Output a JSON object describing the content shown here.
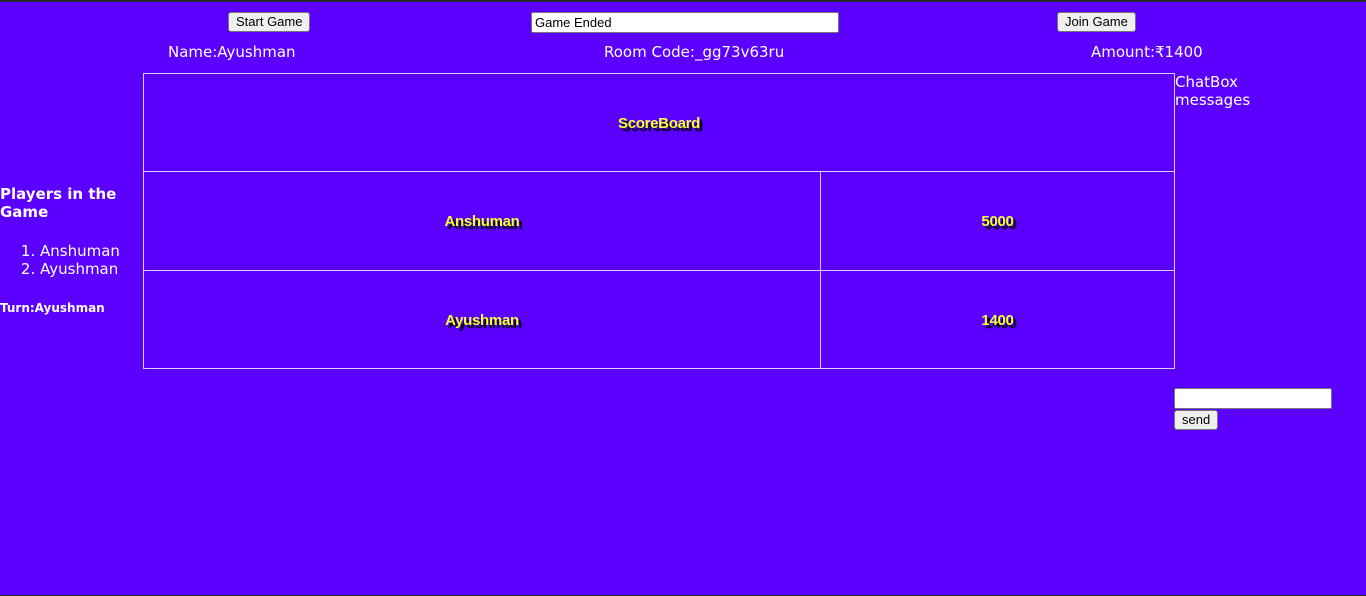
{
  "toolbar": {
    "start_label": "Start Game",
    "status_value": "Game Ended",
    "join_label": "Join Game"
  },
  "info": {
    "name": "Name:Ayushman",
    "room_code": "Room Code:_gg73v63ru",
    "amount": "Amount:₹1400"
  },
  "players": {
    "heading": "Players in the Game",
    "items": [
      "Anshuman",
      "Ayushman"
    ],
    "turn": "Turn:Ayushman"
  },
  "scoreboard": {
    "title": "ScoreBoard",
    "rows": [
      {
        "name": "Anshuman",
        "score": "5000"
      },
      {
        "name": "Ayushman",
        "score": "1400"
      }
    ]
  },
  "chat": {
    "title": "ChatBox",
    "subtitle": "messages",
    "input_value": "",
    "send_label": "send"
  },
  "colors": {
    "background": "#5b00ff",
    "score_text": "#f4ff3a",
    "text_shadow": "#000000"
  }
}
